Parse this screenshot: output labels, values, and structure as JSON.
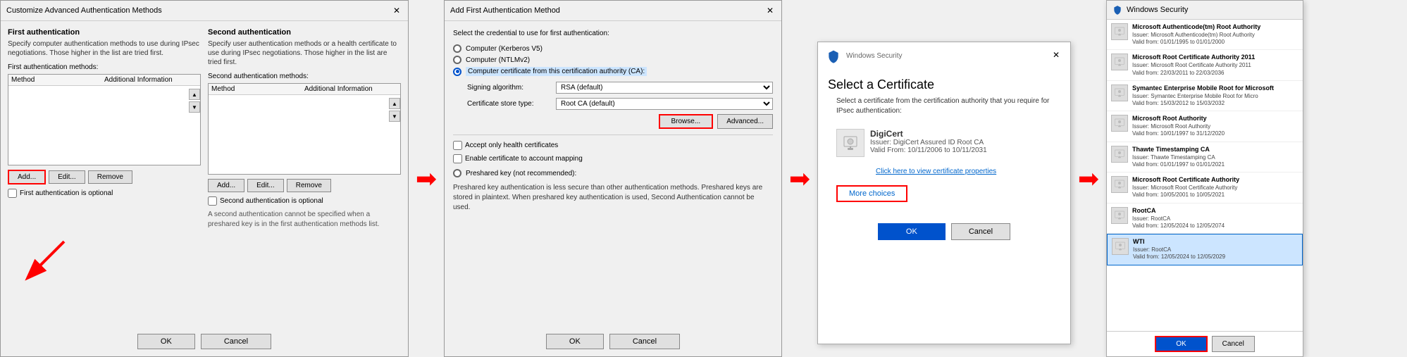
{
  "panel1": {
    "title": "Customize Advanced Authentication Methods",
    "first_auth": {
      "label": "First authentication",
      "desc": "Specify computer authentication methods to use during IPsec negotiations.  Those higher in the list are tried first.",
      "methods_label": "First authentication methods:",
      "col_method": "Method",
      "col_additional": "Additional Information",
      "add_btn": "Add...",
      "edit_btn": "Edit...",
      "remove_btn": "Remove",
      "optional_checkbox": "First authentication is optional"
    },
    "second_auth": {
      "label": "Second authentication",
      "desc": "Specify user authentication methods or a health certificate to use during IPsec negotiations.  Those higher in the list are tried first.",
      "methods_label": "Second authentication methods:",
      "col_method": "Method",
      "col_additional": "Additional Information",
      "add_btn": "Add...",
      "edit_btn": "Edit...",
      "remove_btn": "Remove",
      "optional_checkbox": "Second authentication is optional",
      "note": "A second authentication cannot be specified when a preshared key is in the first authentication methods list."
    },
    "ok_btn": "OK",
    "cancel_btn": "Cancel"
  },
  "panel2": {
    "title": "Add First Authentication Method",
    "desc": "Select the credential to use for first authentication:",
    "options": [
      {
        "id": "kerberos",
        "label": "Computer (Kerberos V5)"
      },
      {
        "id": "ntlm",
        "label": "Computer (NTLMv2)"
      },
      {
        "id": "cert",
        "label": "Computer certificate from this certification authority (CA):",
        "selected": true
      }
    ],
    "signing_algo_label": "Signing algorithm:",
    "signing_algo_value": "RSA (default)",
    "cert_store_label": "Certificate store type:",
    "cert_store_value": "Root CA (default)",
    "browse_btn": "Browse...",
    "advanced_btn": "Advanced...",
    "health_cert_checkbox": "Accept only health certificates",
    "account_mapping_checkbox": "Enable certificate to account mapping",
    "preshared_option": "Preshared key (not recommended):",
    "note": "Preshared key authentication is less secure than other authentication methods. Preshared keys are stored in plaintext. When preshared key authentication is used, Second Authentication cannot be used.",
    "ok_btn": "OK",
    "cancel_btn": "Cancel"
  },
  "panel3": {
    "title": "Windows Security",
    "select_title": "Select a Certificate",
    "desc": "Select a certificate from the certification authority that you require for IPsec authentication:",
    "cert_name": "DigiCert",
    "cert_issuer": "Issuer: DigiCert Assured ID Root CA",
    "cert_validity": "Valid From: 10/11/2006 to 10/11/2031",
    "cert_link": "Click here to view certificate properties",
    "more_choices_btn": "More choices",
    "ok_btn": "OK",
    "cancel_btn": "Cancel"
  },
  "panel4": {
    "title": "Windows Security",
    "certs": [
      {
        "name": "Microsoft Authenticode(tm) Root Authority",
        "issuer": "Issuer: Microsoft Authenticode(tm) Root Authority",
        "validity": "Valid from: 01/01/1995 to 01/01/2000"
      },
      {
        "name": "Microsoft Root Certificate Authority 2011",
        "issuer": "Issuer: Microsoft Root Certificate Authority 2011",
        "validity": "Valid from: 22/03/2011 to 22/03/2036"
      },
      {
        "name": "Symantec Enterprise Mobile Root for Microsoft",
        "issuer": "Issuer: Symantec Enterprise Mobile Root for Micro",
        "validity": "Valid from: 15/03/2012 to 15/03/2032"
      },
      {
        "name": "Microsoft Root Authority",
        "issuer": "Issuer: Microsoft Root Authority",
        "validity": "Valid from: 10/01/1997 to 31/12/2020"
      },
      {
        "name": "Thawte Timestamping CA",
        "issuer": "Issuer: Thawte Timestamping CA",
        "validity": "Valid from: 01/01/1997 to 01/01/2021"
      },
      {
        "name": "Microsoft Root Certificate Authority",
        "issuer": "Issuer: Microsoft Root Certificate Authority",
        "validity": "Valid from: 10/05/2001 to 10/05/2021"
      },
      {
        "name": "RootCA",
        "issuer": "Issuer: RootCA",
        "validity": "Valid from: 12/05/2024 to 12/05/2074"
      },
      {
        "name": "WTI",
        "issuer": "Issuer: RootCA",
        "validity": "Valid from: 12/05/2024 to 12/05/2029",
        "selected": true
      }
    ],
    "ok_btn": "OK",
    "cancel_btn": "Cancel"
  }
}
